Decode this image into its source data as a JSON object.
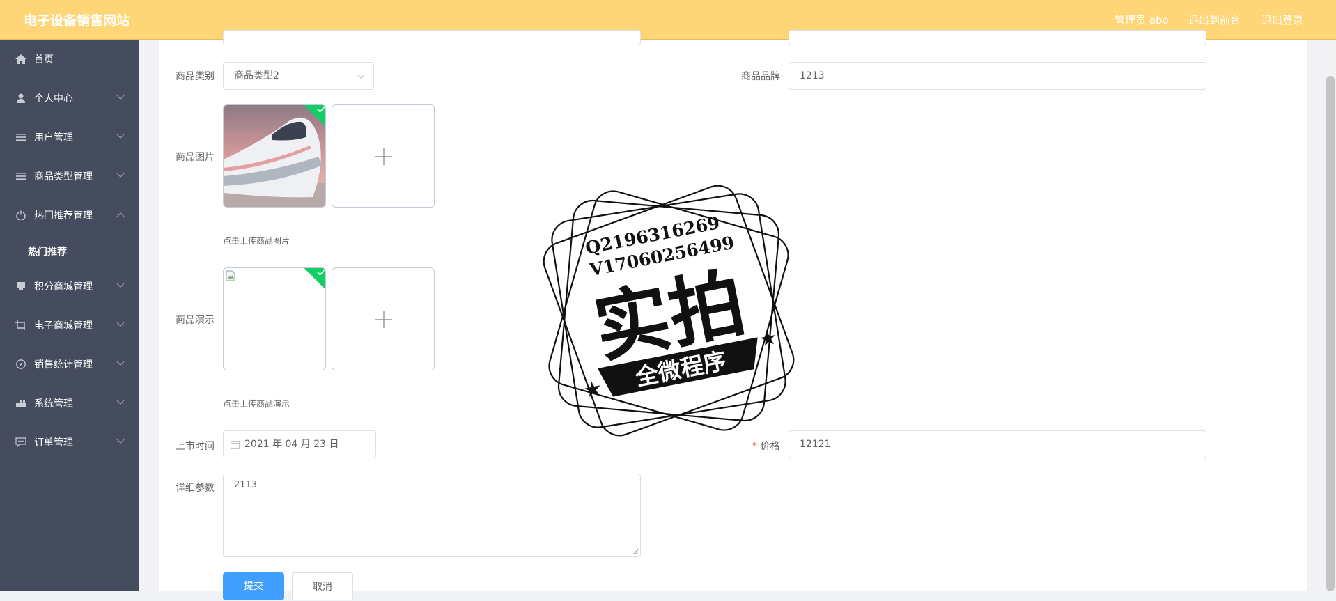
{
  "header": {
    "site_title": "电子设备销售网站",
    "user_label": "管理员 abo",
    "to_front_label": "退出到前台",
    "logout_label": "退出登录",
    "bar_color": "#ffd677"
  },
  "sidebar": {
    "items": [
      {
        "label": "首页",
        "icon": "home-icon"
      },
      {
        "label": "个人中心",
        "icon": "user-icon"
      },
      {
        "label": "用户管理",
        "icon": "list-icon"
      },
      {
        "label": "商品类型管理",
        "icon": "list-icon"
      },
      {
        "label": "热门推荐管理",
        "icon": "power-icon",
        "expanded": true
      },
      {
        "label": "积分商城管理",
        "icon": "goods-icon"
      },
      {
        "label": "电子商城管理",
        "icon": "crop-icon"
      },
      {
        "label": "销售统计管理",
        "icon": "compass-icon"
      },
      {
        "label": "系统管理",
        "icon": "tools-icon"
      },
      {
        "label": "订单管理",
        "icon": "chat-icon"
      }
    ],
    "subitems": [
      {
        "label": "热门推荐",
        "parent": "热门推荐管理",
        "active": true
      }
    ],
    "bg_color": "#444c5e"
  },
  "form": {
    "category": {
      "label": "商品类别",
      "value": "商品类型2"
    },
    "brand": {
      "label": "商品品牌",
      "value": "1213"
    },
    "image": {
      "label": "商品图片",
      "tip": "点击上传商品图片"
    },
    "demo": {
      "label": "商品演示",
      "tip": "点击上传商品演示"
    },
    "release_date": {
      "label": "上市时间",
      "value": "2021 年 04 月 23 日"
    },
    "price": {
      "label": "价格",
      "required_mark": "*",
      "value": "12121"
    },
    "details": {
      "label": "详细参数",
      "value": "2113"
    },
    "submit_label": "提交",
    "cancel_label": "取消",
    "primary_color": "#409eff",
    "success_color": "#13ce66"
  },
  "watermark": {
    "line1": "Q2196316269",
    "line2": "V17060256499",
    "big": "实拍",
    "banner": "全微程序"
  }
}
